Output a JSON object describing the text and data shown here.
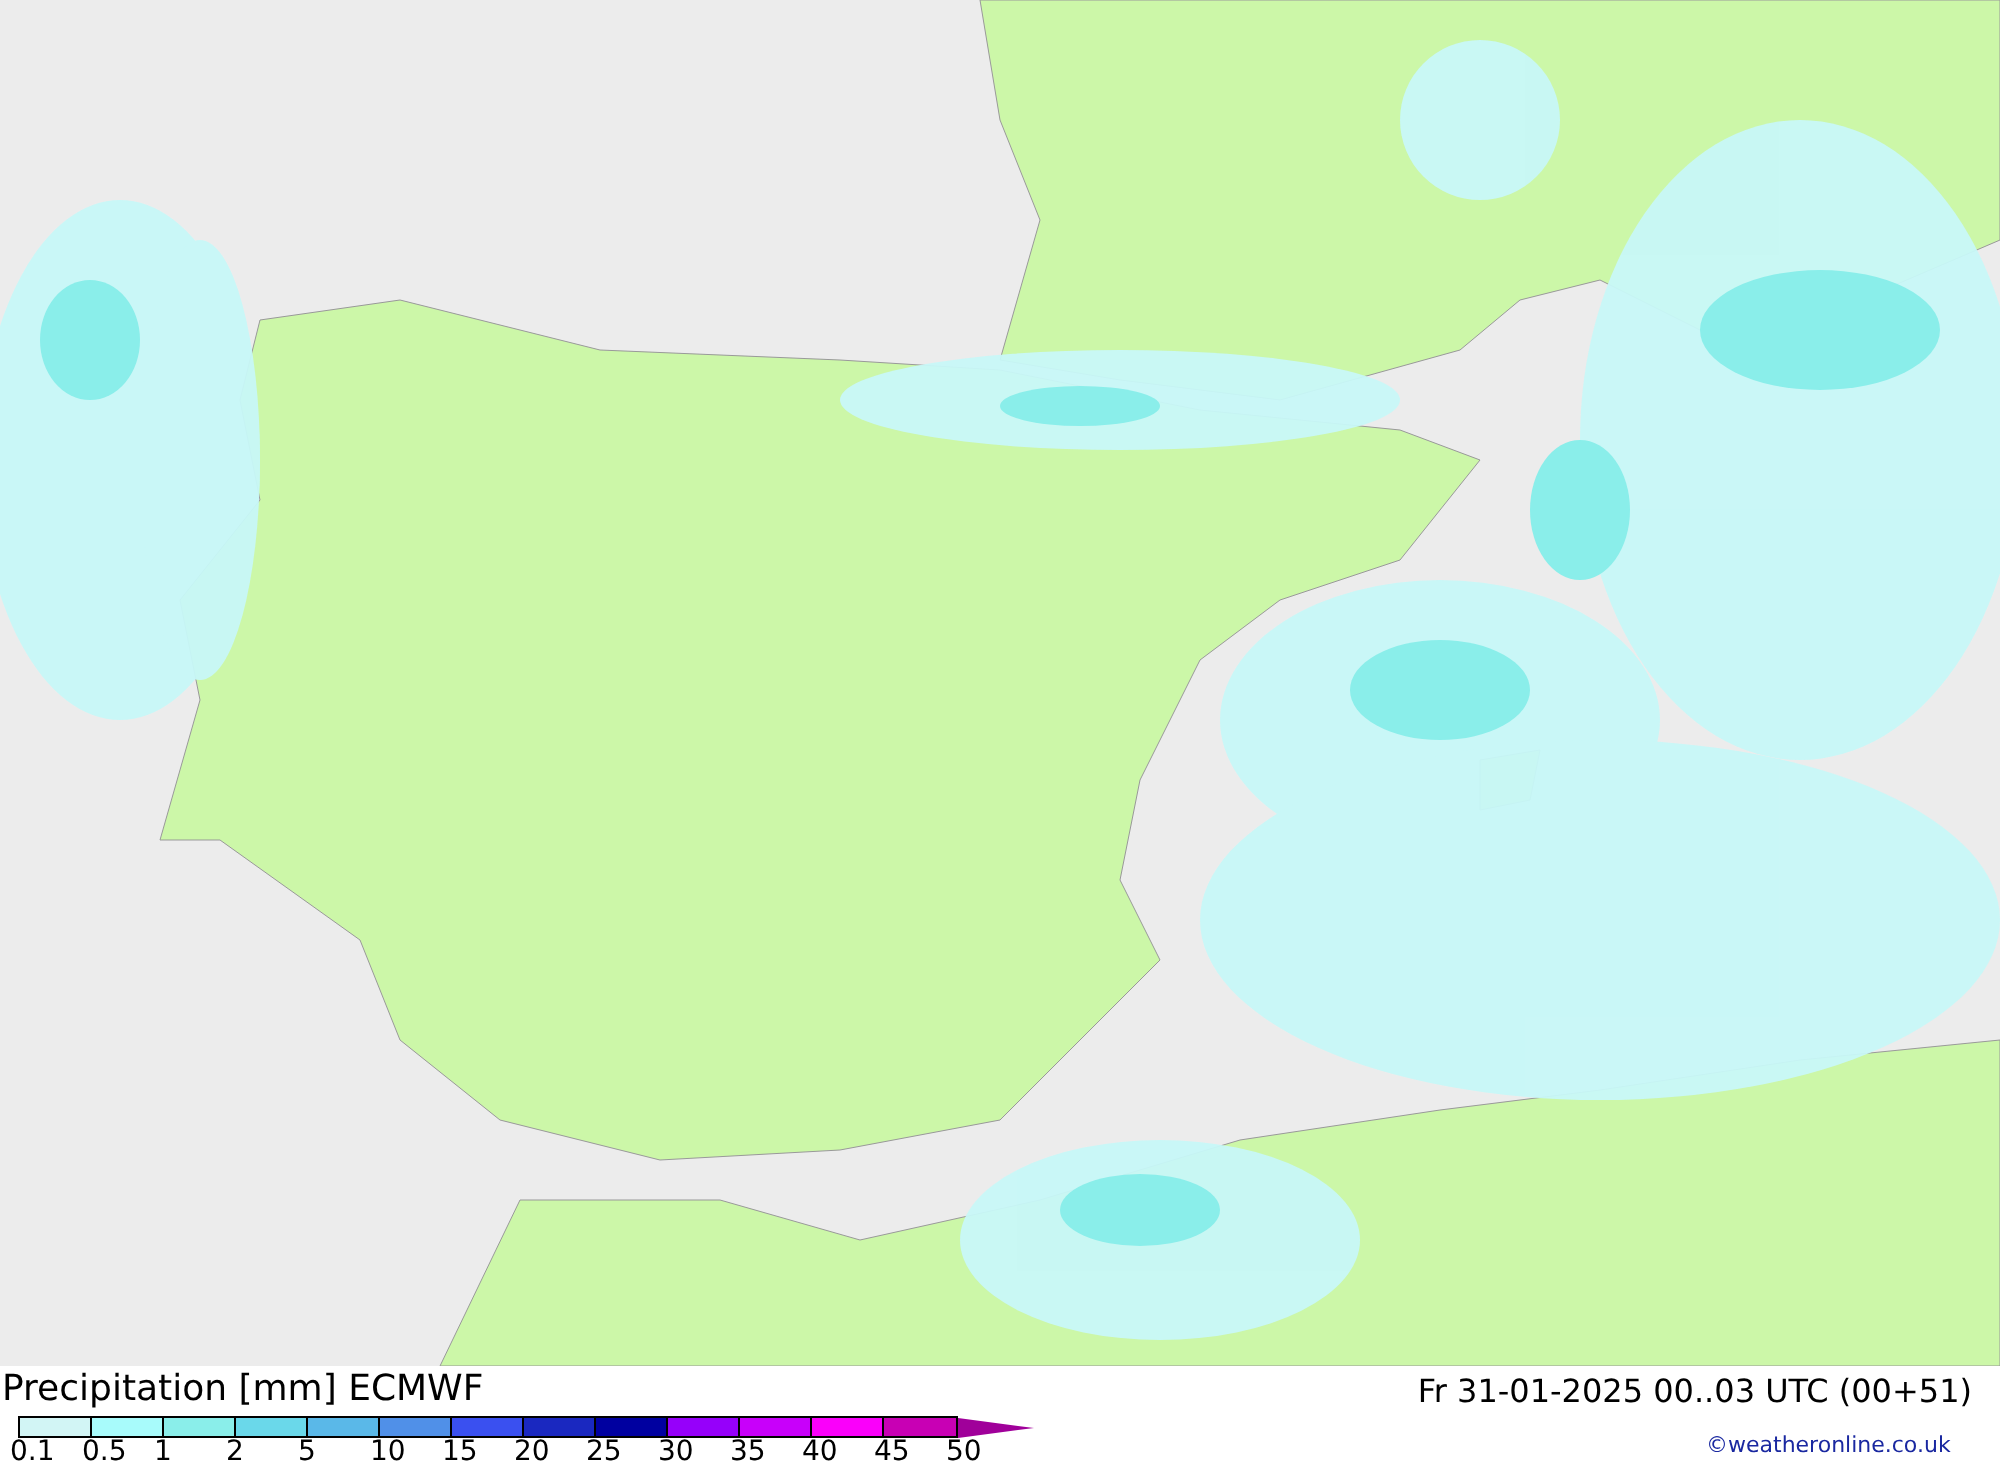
{
  "title": "Precipitation [mm] ECMWF",
  "valid_time": "Fr 31-01-2025 00..03 UTC (00+51)",
  "credit": "©weatheronline.co.uk",
  "legend": {
    "bins": [
      {
        "color": "#d2f5f5"
      },
      {
        "color": "#a8fbfb"
      },
      {
        "color": "#8aeeea"
      },
      {
        "color": "#6ad8ea"
      },
      {
        "color": "#5ab8e8"
      },
      {
        "color": "#5090e8"
      },
      {
        "color": "#3a50f0"
      },
      {
        "color": "#1a28c0"
      },
      {
        "color": "#0000a0"
      },
      {
        "color": "#9600fa"
      },
      {
        "color": "#c800fa"
      },
      {
        "color": "#fa00fa"
      },
      {
        "color": "#c800b4"
      },
      {
        "kind": "arrow",
        "color": "#a0009a"
      }
    ],
    "ticks": [
      "0.1",
      "0.5",
      "1",
      "2",
      "5",
      "10",
      "15",
      "20",
      "25",
      "30",
      "35",
      "40",
      "45",
      "50"
    ]
  }
}
